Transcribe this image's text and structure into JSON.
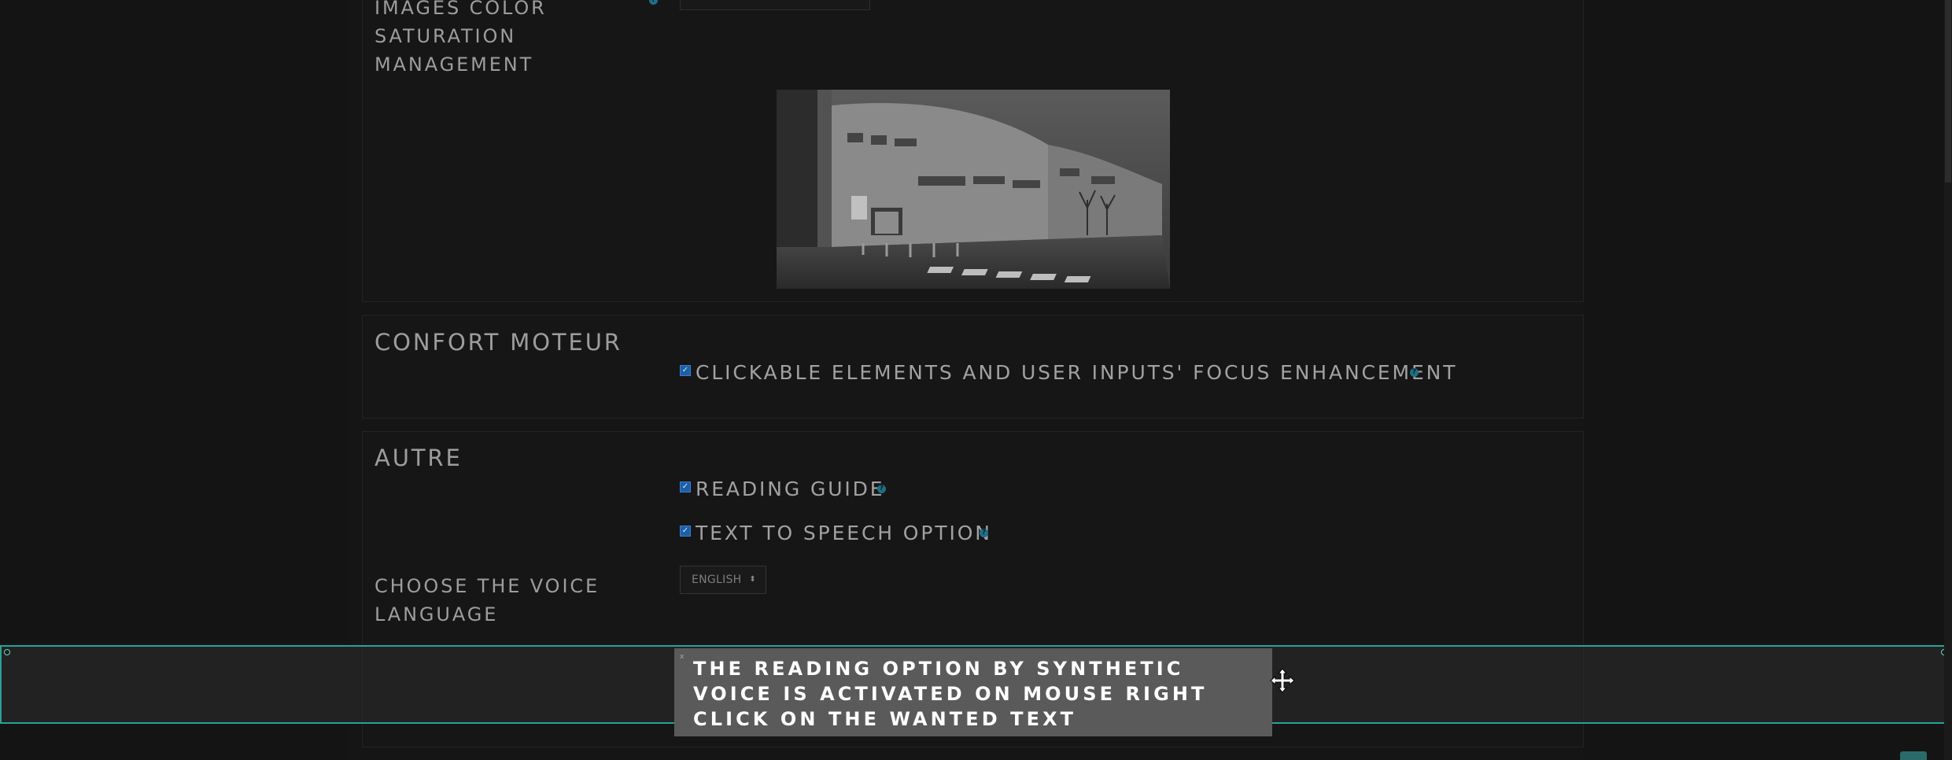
{
  "images_section": {
    "label": "IMAGES COLOR SATURATION MANAGEMENT",
    "label_lines": [
      "IMAGES COLOR",
      "SATURATION",
      "MANAGEMENT"
    ],
    "help_icon": "help-icon"
  },
  "motor_section": {
    "title": "CONFORT MOTEUR",
    "options": [
      {
        "label": "CLICKABLE ELEMENTS AND USER INPUTS' FOCUS ENHANCEMENT",
        "checked": true
      }
    ]
  },
  "other_section": {
    "title": "AUTRE",
    "options": [
      {
        "label": "READING GUIDE",
        "checked": true
      },
      {
        "label": "TEXT TO SPEECH OPTION",
        "checked": true
      }
    ],
    "voice_label_lines": [
      "CHOOSE THE VOICE",
      "LANGUAGE"
    ],
    "voice_select": {
      "selected": "ENGLISH",
      "caret_icon": "updown-caret-icon"
    }
  },
  "tooltip": {
    "text": "THE READING OPTION BY SYNTHETIC VOICE IS ACTIVATED ON MOUSE RIGHT CLICK ON THE WANTED TEXT",
    "close_glyph": "x",
    "cursor_icon": "move-cursor-icon"
  },
  "colors": {
    "background": "#141414",
    "accent_teal": "#2aa198",
    "checkbox_blue": "#1b5fa8",
    "help_blue": "#1e6f86"
  }
}
